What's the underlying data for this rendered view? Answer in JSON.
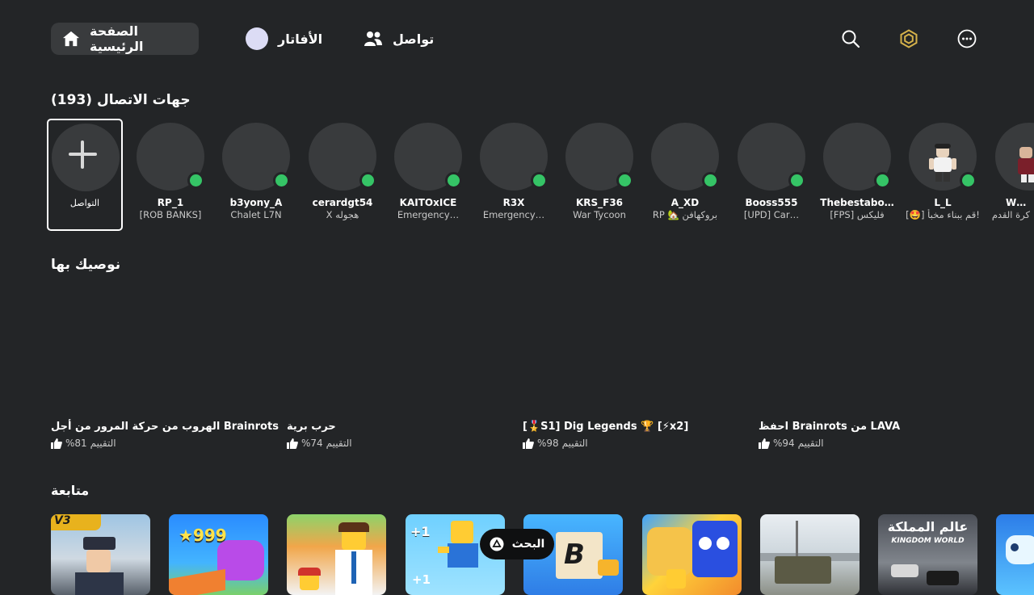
{
  "nav": {
    "home": "الصفحة الرئيسية",
    "avatar": "الأفاتار",
    "connect": "تواصل"
  },
  "contacts_section": {
    "title": "جهات الاتصال (193)",
    "add_label": "التواصل"
  },
  "contacts": [
    {
      "name": "RP_1",
      "status": "[ROB BANKS]",
      "online": true
    },
    {
      "name": "b3yony_A",
      "status": "Chalet L7N",
      "online": true
    },
    {
      "name": "cerardgt54",
      "status": "X هجوله",
      "online": true
    },
    {
      "name": "KAITOxICE",
      "status": "Emergency…",
      "online": true
    },
    {
      "name": "R3X",
      "status": "Emergency…",
      "online": true
    },
    {
      "name": "KRS_F36",
      "status": "War Tycoon",
      "online": true
    },
    {
      "name": "A_XD",
      "status": "RP 🏡 بروكهافن",
      "online": true
    },
    {
      "name": "Booss555",
      "status": "[UPD] Car…",
      "online": true
    },
    {
      "name": "Thebestabo…",
      "status": "[FPS] فليكس",
      "online": true
    },
    {
      "name": "L_L",
      "status": "[🤩] قم ببناء مخبأ!",
      "online": true
    },
    {
      "name": "WOW",
      "status": "كرة القدم",
      "online": false
    }
  ],
  "recommended": {
    "title": "نوصيك بها",
    "rating_label": "التقييم",
    "items": [
      {
        "title": "الهروب من حركة المرور من أجل Brainrots",
        "rating": "%81"
      },
      {
        "title": "حرب برية",
        "rating": "%74"
      },
      {
        "title": "[🎖️S1] Dig Legends 🏆 [⚡x2]",
        "rating": "%98"
      },
      {
        "title": "احفظ Brainrots من LAVA",
        "rating": "%94"
      }
    ]
  },
  "continue": {
    "title": "متابعة",
    "tiles": [
      {
        "badge": "V3"
      },
      {
        "badge": "999"
      },
      {
        "badge": ""
      },
      {
        "badge": "+1"
      },
      {
        "badge": "B"
      },
      {
        "badge": ""
      },
      {
        "badge": ""
      },
      {
        "badge": "عالم المملكة"
      },
      {
        "badge": ""
      }
    ],
    "kingdom_sub": "KINGDOM WORLD"
  },
  "search_pill": {
    "label": "البحث"
  },
  "colors": {
    "background": "#232527",
    "pill": "#393b3d",
    "online": "#35c466",
    "robux": "#d4b14a"
  }
}
